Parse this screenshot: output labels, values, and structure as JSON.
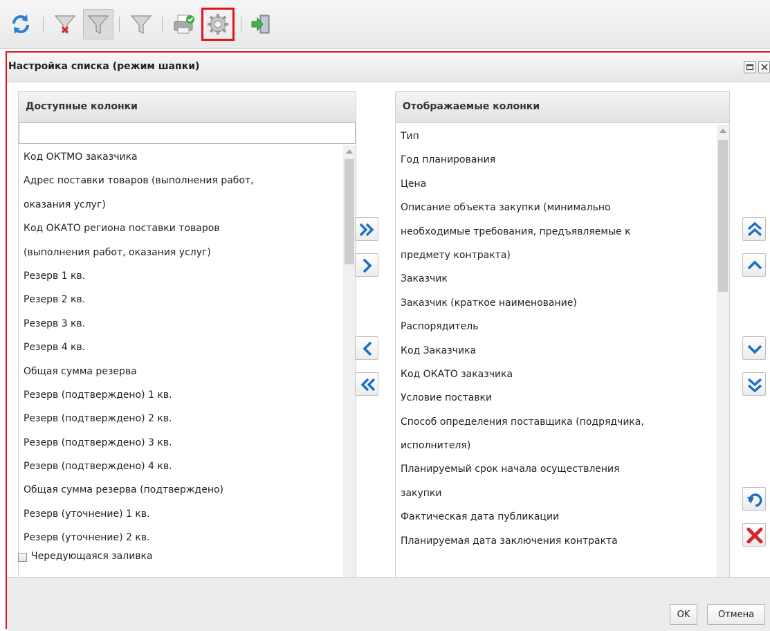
{
  "toolbar": {
    "buttons": [
      {
        "icon": "refresh-icon"
      },
      {
        "icon": "filter-clear-icon"
      },
      {
        "icon": "filter-toggle-icon",
        "state": "pressed"
      },
      {
        "icon": "filter-icon"
      },
      {
        "icon": "print-icon"
      },
      {
        "icon": "gear-icon",
        "state": "highlighted"
      },
      {
        "icon": "exit-icon"
      }
    ],
    "highlight_color": "#e0141e"
  },
  "dialog": {
    "title": "Настройка списка (режим шапки)",
    "available": {
      "header": "Доступные колонки",
      "search_value": "",
      "items": [
        "Код ОКТМО заказчика",
        "Адрес поставки товаров (выполнения работ,",
        "оказания услуг)",
        "Код ОКАТО региона поставки товаров",
        "(выполнения работ, оказания услуг)",
        "Резерв 1 кв.",
        "Резерв 2 кв.",
        "Резерв 3 кв.",
        "Резерв 4 кв.",
        "Общая сумма резерва",
        "Резерв (подтверждено) 1 кв.",
        "Резерв (подтверждено) 2 кв.",
        "Резерв (подтверждено) 3 кв.",
        "Резерв (подтверждено) 4 кв.",
        "Общая сумма резерва (подтверждено)",
        "Резерв (уточнение) 1 кв.",
        "Резерв (уточнение) 2 кв."
      ]
    },
    "displayed": {
      "header": "Отображаемые колонки",
      "items": [
        "Тип",
        "Год планирования",
        "Цена",
        "Описание объекта закупки (минимально",
        "необходимые требования, предъявляемые к",
        "предмету контракта)",
        "Заказчик",
        "Заказчик (краткое наименование)",
        "Распорядитель",
        "Код Заказчика",
        "Код ОКАТО заказчика",
        "Условие поставки",
        "Способ определения поставщика (подрядчика,",
        "исполнителя)",
        "Планируемый срок начала осуществления",
        "закупки",
        "Фактическая дата публикации",
        "Планируемая дата заключения контракта"
      ]
    },
    "move_buttons": [
      "move-all-right-icon",
      "move-right-icon",
      "move-left-icon",
      "move-all-left-icon"
    ],
    "order_buttons": [
      "move-top-icon",
      "move-up-icon",
      "move-down-icon",
      "move-bottom-icon",
      "undo-icon",
      "delete-icon"
    ],
    "checkbox": {
      "label": "Чередующаяся заливка",
      "checked": false
    },
    "ok_label": "OK",
    "cancel_label": "Отмена"
  },
  "colors": {
    "accent_blue": "#1a6fc4",
    "delete_red": "#d8232a",
    "frame_red": "#e0141e"
  }
}
